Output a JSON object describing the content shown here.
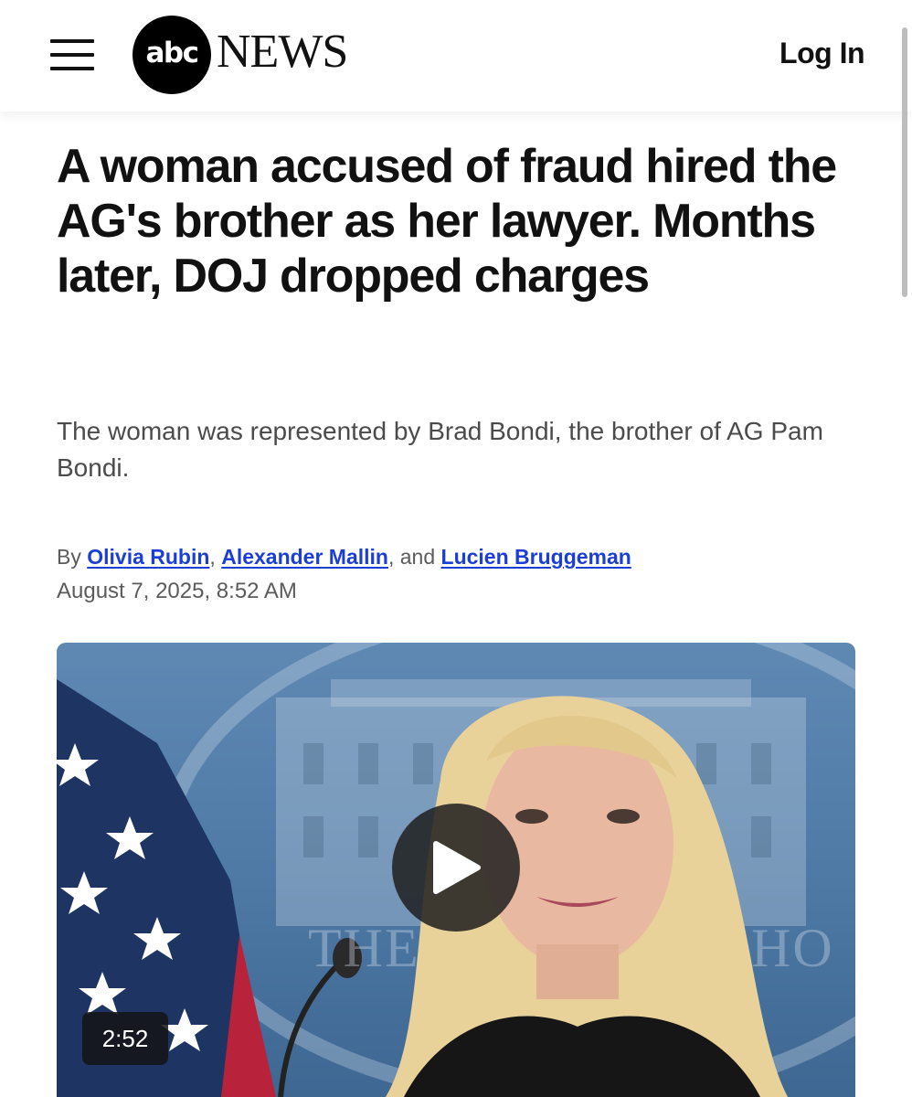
{
  "header": {
    "logo_circle_text": "abc",
    "logo_wordmark": "NEWS",
    "login_label": "Log In",
    "menu_icon": "hamburger-menu-icon"
  },
  "article": {
    "headline": "A woman accused of fraud hired the AG's brother as her lawyer. Months later, DOJ dropped charges",
    "dek": "The woman was represented by Brad Bondi, the brother of AG Pam Bondi.",
    "byline": {
      "prefix": "By",
      "authors": [
        "Olivia Rubin",
        "Alexander Mallin",
        "Lucien Bruggeman"
      ],
      "sep1": ",",
      "sep2": ", and"
    },
    "date": "August 7, 2025, 8:52 AM"
  },
  "video": {
    "duration": "2:52",
    "play_icon": "play-icon",
    "backdrop_text_left": "THE",
    "backdrop_text_right": "HO"
  },
  "colors": {
    "link": "#1b3fd6",
    "text": "#111111",
    "muted": "#5b5b5b"
  }
}
